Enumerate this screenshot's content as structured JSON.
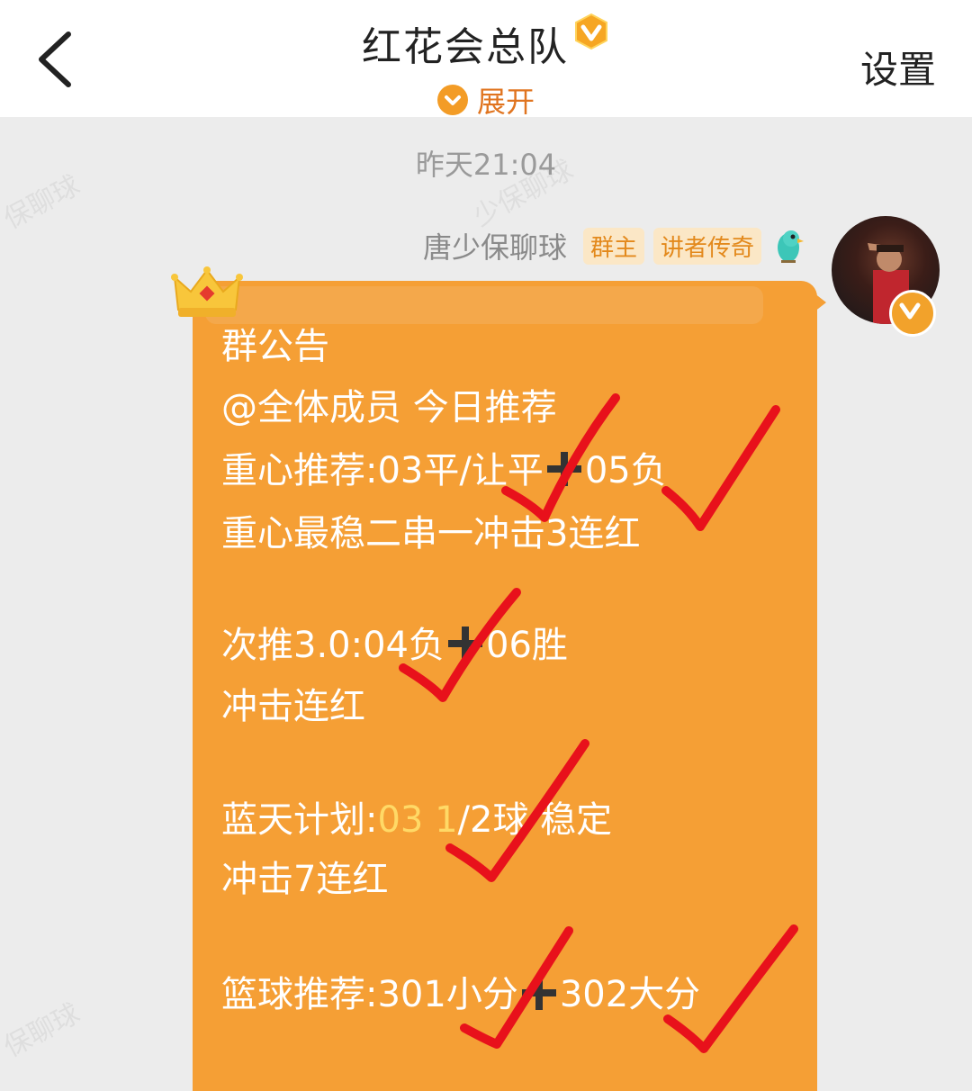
{
  "header": {
    "back_icon": "chevron-left-icon",
    "title": "红花会总队",
    "verified_icon": "v-badge-icon",
    "expand_label": "展开",
    "settings_label": "设置"
  },
  "chat": {
    "timestamp": "昨天21:04",
    "sender": {
      "name": "唐少保聊球",
      "tags": [
        "群主",
        "讲者传奇"
      ],
      "bird_icon": "parrot-icon"
    },
    "message": {
      "header": "群公告",
      "lines": {
        "l1": "@全体成员 今日推荐",
        "l2a": "重心推荐:03平/让平",
        "l2b": "05负",
        "l3": "重心最稳二串一冲击3连红",
        "l4a": "次推3.0:04负",
        "l4b": "06胜",
        "l5": "冲击连红",
        "l6a": "蓝天计划:",
        "l6hl": "03 1",
        "l6b": "/2球 稳定",
        "l7": "冲击7连红",
        "l8a": "篮球推荐:301小分",
        "l8b": "302大分"
      }
    }
  },
  "colors": {
    "bubble": "#f59f35",
    "accent": "#e0741f",
    "check_mark": "#e8111b",
    "highlight": "#ffd966"
  }
}
